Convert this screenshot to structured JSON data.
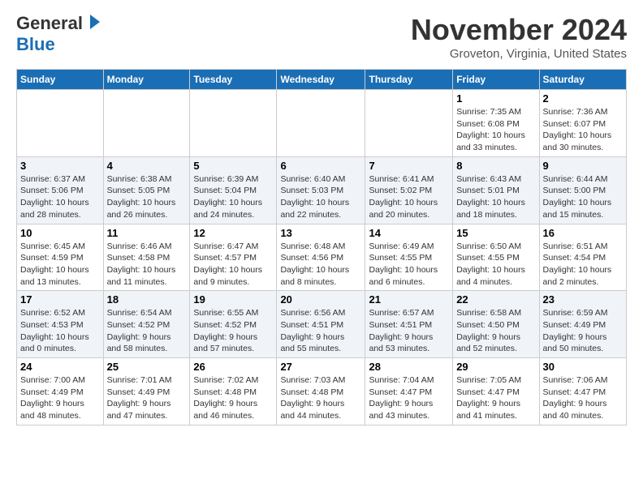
{
  "header": {
    "logo_general": "General",
    "logo_blue": "Blue",
    "month_title": "November 2024",
    "location": "Groveton, Virginia, United States"
  },
  "weekdays": [
    "Sunday",
    "Monday",
    "Tuesday",
    "Wednesday",
    "Thursday",
    "Friday",
    "Saturday"
  ],
  "weeks": [
    [
      {
        "day": "",
        "info": ""
      },
      {
        "day": "",
        "info": ""
      },
      {
        "day": "",
        "info": ""
      },
      {
        "day": "",
        "info": ""
      },
      {
        "day": "",
        "info": ""
      },
      {
        "day": "1",
        "info": "Sunrise: 7:35 AM\nSunset: 6:08 PM\nDaylight: 10 hours\nand 33 minutes."
      },
      {
        "day": "2",
        "info": "Sunrise: 7:36 AM\nSunset: 6:07 PM\nDaylight: 10 hours\nand 30 minutes."
      }
    ],
    [
      {
        "day": "3",
        "info": "Sunrise: 6:37 AM\nSunset: 5:06 PM\nDaylight: 10 hours\nand 28 minutes."
      },
      {
        "day": "4",
        "info": "Sunrise: 6:38 AM\nSunset: 5:05 PM\nDaylight: 10 hours\nand 26 minutes."
      },
      {
        "day": "5",
        "info": "Sunrise: 6:39 AM\nSunset: 5:04 PM\nDaylight: 10 hours\nand 24 minutes."
      },
      {
        "day": "6",
        "info": "Sunrise: 6:40 AM\nSunset: 5:03 PM\nDaylight: 10 hours\nand 22 minutes."
      },
      {
        "day": "7",
        "info": "Sunrise: 6:41 AM\nSunset: 5:02 PM\nDaylight: 10 hours\nand 20 minutes."
      },
      {
        "day": "8",
        "info": "Sunrise: 6:43 AM\nSunset: 5:01 PM\nDaylight: 10 hours\nand 18 minutes."
      },
      {
        "day": "9",
        "info": "Sunrise: 6:44 AM\nSunset: 5:00 PM\nDaylight: 10 hours\nand 15 minutes."
      }
    ],
    [
      {
        "day": "10",
        "info": "Sunrise: 6:45 AM\nSunset: 4:59 PM\nDaylight: 10 hours\nand 13 minutes."
      },
      {
        "day": "11",
        "info": "Sunrise: 6:46 AM\nSunset: 4:58 PM\nDaylight: 10 hours\nand 11 minutes."
      },
      {
        "day": "12",
        "info": "Sunrise: 6:47 AM\nSunset: 4:57 PM\nDaylight: 10 hours\nand 9 minutes."
      },
      {
        "day": "13",
        "info": "Sunrise: 6:48 AM\nSunset: 4:56 PM\nDaylight: 10 hours\nand 8 minutes."
      },
      {
        "day": "14",
        "info": "Sunrise: 6:49 AM\nSunset: 4:55 PM\nDaylight: 10 hours\nand 6 minutes."
      },
      {
        "day": "15",
        "info": "Sunrise: 6:50 AM\nSunset: 4:55 PM\nDaylight: 10 hours\nand 4 minutes."
      },
      {
        "day": "16",
        "info": "Sunrise: 6:51 AM\nSunset: 4:54 PM\nDaylight: 10 hours\nand 2 minutes."
      }
    ],
    [
      {
        "day": "17",
        "info": "Sunrise: 6:52 AM\nSunset: 4:53 PM\nDaylight: 10 hours\nand 0 minutes."
      },
      {
        "day": "18",
        "info": "Sunrise: 6:54 AM\nSunset: 4:52 PM\nDaylight: 9 hours\nand 58 minutes."
      },
      {
        "day": "19",
        "info": "Sunrise: 6:55 AM\nSunset: 4:52 PM\nDaylight: 9 hours\nand 57 minutes."
      },
      {
        "day": "20",
        "info": "Sunrise: 6:56 AM\nSunset: 4:51 PM\nDaylight: 9 hours\nand 55 minutes."
      },
      {
        "day": "21",
        "info": "Sunrise: 6:57 AM\nSunset: 4:51 PM\nDaylight: 9 hours\nand 53 minutes."
      },
      {
        "day": "22",
        "info": "Sunrise: 6:58 AM\nSunset: 4:50 PM\nDaylight: 9 hours\nand 52 minutes."
      },
      {
        "day": "23",
        "info": "Sunrise: 6:59 AM\nSunset: 4:49 PM\nDaylight: 9 hours\nand 50 minutes."
      }
    ],
    [
      {
        "day": "24",
        "info": "Sunrise: 7:00 AM\nSunset: 4:49 PM\nDaylight: 9 hours\nand 48 minutes."
      },
      {
        "day": "25",
        "info": "Sunrise: 7:01 AM\nSunset: 4:49 PM\nDaylight: 9 hours\nand 47 minutes."
      },
      {
        "day": "26",
        "info": "Sunrise: 7:02 AM\nSunset: 4:48 PM\nDaylight: 9 hours\nand 46 minutes."
      },
      {
        "day": "27",
        "info": "Sunrise: 7:03 AM\nSunset: 4:48 PM\nDaylight: 9 hours\nand 44 minutes."
      },
      {
        "day": "28",
        "info": "Sunrise: 7:04 AM\nSunset: 4:47 PM\nDaylight: 9 hours\nand 43 minutes."
      },
      {
        "day": "29",
        "info": "Sunrise: 7:05 AM\nSunset: 4:47 PM\nDaylight: 9 hours\nand 41 minutes."
      },
      {
        "day": "30",
        "info": "Sunrise: 7:06 AM\nSunset: 4:47 PM\nDaylight: 9 hours\nand 40 minutes."
      }
    ]
  ]
}
